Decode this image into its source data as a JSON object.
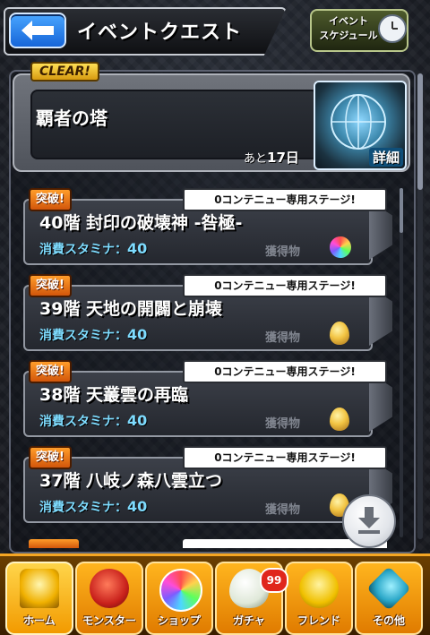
{
  "header": {
    "title": "イベントクエスト",
    "schedule_line1": "イベント",
    "schedule_line2": "スケジュール"
  },
  "event": {
    "clear_badge": "CLEAR!",
    "title": "覇者の塔",
    "remaining_prefix": "あと",
    "remaining_days": "17日",
    "detail_label": "詳細"
  },
  "stages": [
    {
      "badge": "突破!",
      "continue_tag": "0コンテニュー専用ステージ!",
      "name": "40階 封印の破壊神 -咎極-",
      "stamina_label": "消費スタミナ：",
      "stamina_value": "40",
      "reward_label": "獲得物",
      "reward_icon": "rainbow-orb-icon"
    },
    {
      "badge": "突破!",
      "continue_tag": "0コンテニュー専用ステージ!",
      "name": "39階 天地の開闢と崩壊",
      "stamina_label": "消費スタミナ：",
      "stamina_value": "40",
      "reward_label": "獲得物",
      "reward_icon": "golden-egg-icon"
    },
    {
      "badge": "突破!",
      "continue_tag": "0コンテニュー専用ステージ!",
      "name": "38階 天叢雲の再臨",
      "stamina_label": "消費スタミナ：",
      "stamina_value": "40",
      "reward_label": "獲得物",
      "reward_icon": "golden-egg-icon"
    },
    {
      "badge": "突破!",
      "continue_tag": "0コンテニュー専用ステージ!",
      "name": "37階 八岐ノ森八雲立つ",
      "stamina_label": "消費スタミナ：",
      "stamina_value": "40",
      "reward_label": "獲得物",
      "reward_icon": "golden-egg-icon"
    }
  ],
  "nav": {
    "items": [
      {
        "label": "ホーム",
        "icon": "home-icon"
      },
      {
        "label": "モンスター",
        "icon": "monster-icon"
      },
      {
        "label": "ショップ",
        "icon": "shop-orb-icon"
      },
      {
        "label": "ガチャ",
        "icon": "gacha-egg-icon"
      },
      {
        "label": "フレンド",
        "icon": "friend-icon"
      },
      {
        "label": "その他",
        "icon": "other-icon"
      }
    ],
    "gacha_count": "99"
  },
  "colors": {
    "accent_orange": "#f29a00",
    "stamina_blue": "#7edcff",
    "back_button_blue": "#1665d8"
  }
}
